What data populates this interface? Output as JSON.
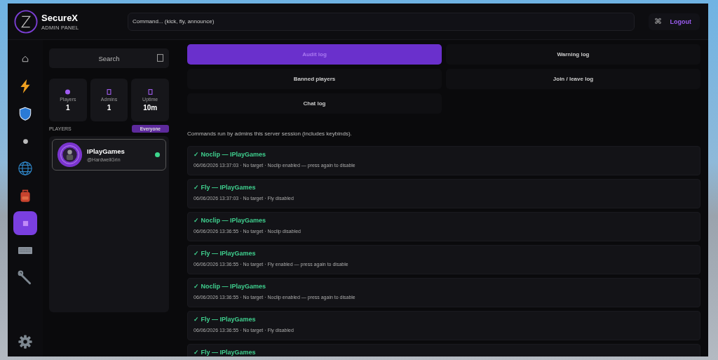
{
  "brand": {
    "name": "SecureX",
    "subtitle": "ADMIN PANEL"
  },
  "command_field": {
    "placeholder": "Command... (kick, fly, announce)"
  },
  "header_actions": {
    "shortcut_symbol": "⌘",
    "logout": "Logout"
  },
  "sidebar": {
    "items": [
      {
        "kind": "home",
        "selected": false
      },
      {
        "kind": "lightning",
        "selected": false
      },
      {
        "kind": "shield",
        "selected": false
      },
      {
        "kind": "dot",
        "selected": false
      },
      {
        "kind": "globe",
        "selected": false
      },
      {
        "kind": "backpack",
        "selected": false
      },
      {
        "kind": "square",
        "selected": true
      },
      {
        "kind": "keyboard",
        "selected": false
      },
      {
        "kind": "wrench",
        "selected": false
      }
    ]
  },
  "search": {
    "placeholder": "Search"
  },
  "stats": [
    {
      "kind": "dot",
      "label": "Players",
      "value": "1"
    },
    {
      "kind": "rect",
      "label": "Admins",
      "value": "1"
    },
    {
      "kind": "rect",
      "label": "Uptime",
      "value": "10m"
    }
  ],
  "players_header": {
    "title": "PLAYERS",
    "filter": "Everyone"
  },
  "players": [
    {
      "name": "IPlayGames",
      "handle": "@HardwellGrin",
      "online": true
    }
  ],
  "tabs": [
    {
      "label": "Audit log",
      "selected": true
    },
    {
      "label": "Warning log",
      "selected": false
    },
    {
      "label": "Banned players",
      "selected": false
    },
    {
      "label": "Join / leave log",
      "selected": false
    },
    {
      "label": "Chat log",
      "selected": false
    }
  ],
  "description": "Commands run by admins this server session (includes keybinds).",
  "log_entries": [
    {
      "title": "✓ Noclip — IPlayGames",
      "detail": "06/06/2026 13:37:03 · No target · Noclip enabled — press again to disable"
    },
    {
      "title": "✓ Fly — IPlayGames",
      "detail": "06/06/2026 13:37:03 · No target · Fly disabled"
    },
    {
      "title": "✓ Noclip — IPlayGames",
      "detail": "06/06/2026 13:36:55 · No target · Noclip disabled"
    },
    {
      "title": "✓ Fly — IPlayGames",
      "detail": "06/06/2026 13:36:55 · No target · Fly enabled — press again to disable"
    },
    {
      "title": "✓ Noclip — IPlayGames",
      "detail": "06/06/2026 13:36:55 · No target · Noclip enabled — press again to disable"
    },
    {
      "title": "✓ Fly — IPlayGames",
      "detail": "06/06/2026 13:36:55 · No target · Fly disabled"
    },
    {
      "title": "✓ Fly — IPlayGames"
    }
  ]
}
